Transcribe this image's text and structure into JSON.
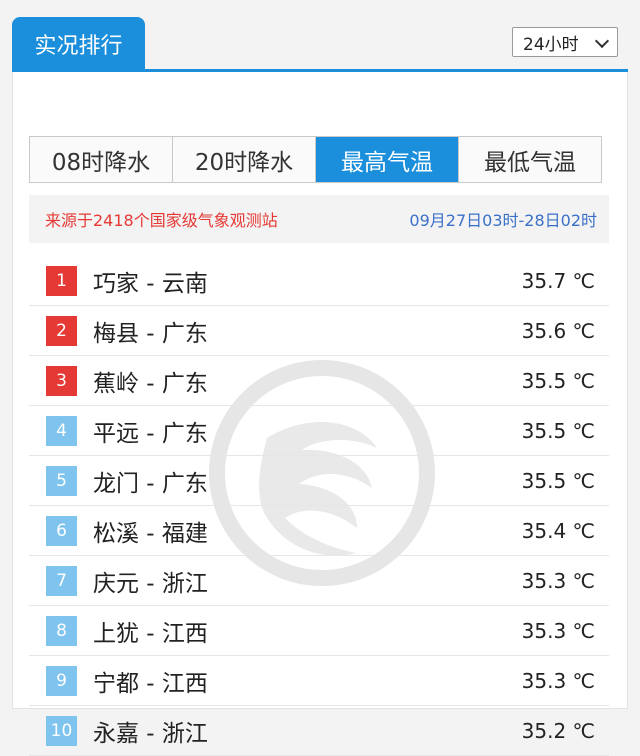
{
  "title": "实况排行",
  "period_select": {
    "value": "24小时"
  },
  "tabs": [
    {
      "label": "08时降水",
      "active": false
    },
    {
      "label": "20时降水",
      "active": false
    },
    {
      "label": "最高气温",
      "active": true
    },
    {
      "label": "最低气温",
      "active": false
    }
  ],
  "source": {
    "text": "来源于2418个国家级气象观测站",
    "time_range": "09月27日03时-28日02时"
  },
  "ranking": [
    {
      "rank": "1",
      "place": "巧家 - 云南",
      "value": "35.7 ℃",
      "color": "red"
    },
    {
      "rank": "2",
      "place": "梅县 - 广东",
      "value": "35.6 ℃",
      "color": "red"
    },
    {
      "rank": "3",
      "place": "蕉岭 - 广东",
      "value": "35.5 ℃",
      "color": "red"
    },
    {
      "rank": "4",
      "place": "平远 - 广东",
      "value": "35.5 ℃",
      "color": "blue"
    },
    {
      "rank": "5",
      "place": "龙门 - 广东",
      "value": "35.5 ℃",
      "color": "blue"
    },
    {
      "rank": "6",
      "place": "松溪 - 福建",
      "value": "35.4 ℃",
      "color": "blue"
    },
    {
      "rank": "7",
      "place": "庆元 - 浙江",
      "value": "35.3 ℃",
      "color": "blue"
    },
    {
      "rank": "8",
      "place": "上犹 - 江西",
      "value": "35.3 ℃",
      "color": "blue"
    },
    {
      "rank": "9",
      "place": "宁都 - 江西",
      "value": "35.3 ℃",
      "color": "blue"
    },
    {
      "rank": "10",
      "place": "永嘉 - 浙江",
      "value": "35.2 ℃",
      "color": "blue"
    }
  ],
  "colors": {
    "accent": "#1b8fdb",
    "top_rank": "#e53935",
    "other_rank": "#7ec4ee",
    "time_text": "#3a70c8"
  },
  "watermark_icon": "weather-logo-watermark-icon"
}
